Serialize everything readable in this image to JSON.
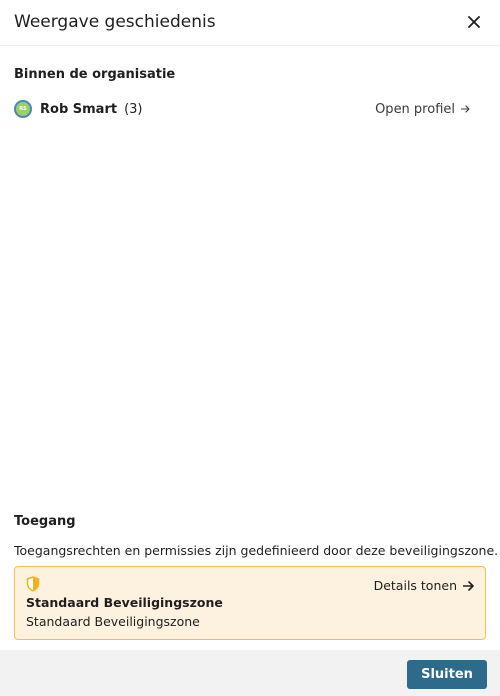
{
  "dialog": {
    "title": "Weergave geschiedenis",
    "close_icon": "close-icon"
  },
  "organization": {
    "heading": "Binnen de organisatie",
    "user": {
      "avatar_icon": "avatar-icon",
      "name": "Rob Smart",
      "count": "(3)",
      "open_profile_label": "Open profiel"
    }
  },
  "access": {
    "heading": "Toegang",
    "description": "Toegangsrechten en permissies zijn gedefinieerd door deze beveiligingszone.",
    "zone": {
      "icon": "shield-icon",
      "details_label": "Details tonen",
      "name": "Standaard Beveiligingszone",
      "subtitle": "Standaard Beveiligingszone"
    }
  },
  "footer": {
    "close_label": "Sluiten"
  },
  "colors": {
    "primary_button": "#2d6a8b",
    "zone_background": "#fdf1e0",
    "zone_border": "#f0c24a",
    "shield": "#f2b21a"
  }
}
